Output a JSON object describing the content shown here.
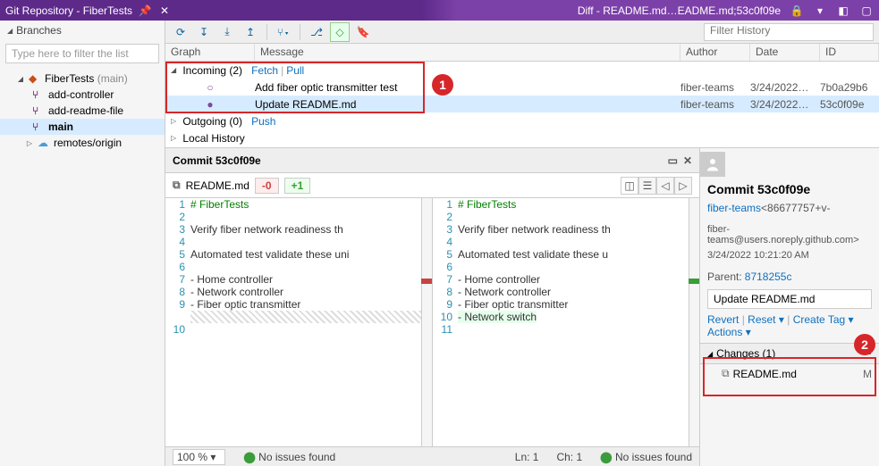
{
  "titlebar": {
    "left_title": "Git Repository - FiberTests",
    "right_title": "Diff - README.md…EADME.md;53c0f09e"
  },
  "sidebar": {
    "branches_label": "Branches",
    "filter_placeholder": "Type here to filter the list",
    "repo_name": "FiberTests",
    "repo_branch_suffix": "(main)",
    "items": [
      {
        "label": "add-controller"
      },
      {
        "label": "add-readme-file"
      },
      {
        "label": "main"
      }
    ],
    "remotes_label": "remotes/origin"
  },
  "toolbar": {
    "filter_history_placeholder": "Filter History"
  },
  "history": {
    "cols": {
      "graph": "Graph",
      "message": "Message",
      "author": "Author",
      "date": "Date",
      "id": "ID"
    },
    "incoming_label": "Incoming (2)",
    "fetch": "Fetch",
    "pull": "Pull",
    "outgoing_label": "Outgoing (0)",
    "push": "Push",
    "local_label": "Local History",
    "commits": [
      {
        "msg": "Add fiber optic transmitter test",
        "author": "fiber-teams",
        "date": "3/24/2022…",
        "id": "7b0a29b6"
      },
      {
        "msg": "Update README.md",
        "author": "fiber-teams",
        "date": "3/24/2022…",
        "id": "53c0f09e"
      }
    ]
  },
  "commit_panel": {
    "header": "Commit 53c0f09e",
    "file": "README.md",
    "minus": "-0",
    "plus": "+1"
  },
  "diff": {
    "left": [
      "# FiberTests",
      "",
      "Verify fiber network readiness th",
      "",
      "Automated test validate these uni",
      "",
      "- Home controller",
      "- Network controller",
      "- Fiber optic transmitter"
    ],
    "right": [
      "# FiberTests",
      "",
      "Verify fiber network readiness th",
      "",
      "Automated test validate these u",
      "",
      "- Home controller",
      "- Network controller",
      "- Fiber optic transmitter",
      "- Network switch"
    ]
  },
  "details": {
    "header": "Commit 53c0f09e",
    "author": "fiber-teams",
    "author_id": "<86677757+v-",
    "email": "fiber-teams@users.noreply.github.com>",
    "timestamp": "3/24/2022 10:21:20 AM",
    "parent_label": "Parent:",
    "parent": "8718255c",
    "message": "Update README.md",
    "actions": {
      "revert": "Revert",
      "reset": "Reset",
      "create_tag": "Create Tag",
      "more": "Actions"
    },
    "changes_label": "Changes (1)",
    "changed_file": "README.md",
    "changed_mark": "M"
  },
  "statusbar": {
    "zoom": "100 %",
    "issues": "No issues found",
    "line": "Ln: 1",
    "col": "Ch: 1",
    "issues2": "No issues found"
  },
  "callouts": {
    "n1": "1",
    "n2": "2"
  }
}
